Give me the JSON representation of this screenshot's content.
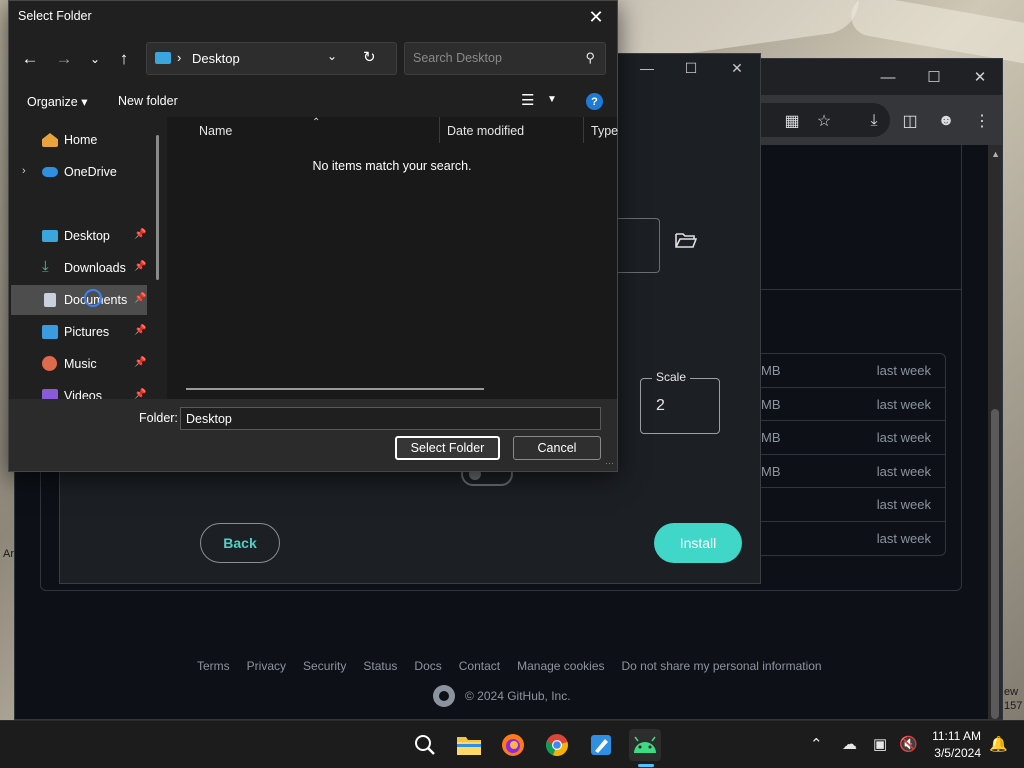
{
  "dialog": {
    "title": "Select Folder",
    "address": "Desktop",
    "search_placeholder": "Search Desktop",
    "organize_label": "Organize",
    "new_folder_label": "New folder",
    "nav_items": [
      {
        "label": "Home",
        "icon": "home-icon"
      },
      {
        "label": "OneDrive",
        "icon": "onedrive-icon"
      },
      {
        "label": "Desktop",
        "icon": "desktop-folder-icon"
      },
      {
        "label": "Downloads",
        "icon": "downloads-icon"
      },
      {
        "label": "Documents",
        "icon": "documents-icon"
      },
      {
        "label": "Pictures",
        "icon": "pictures-icon"
      },
      {
        "label": "Music",
        "icon": "music-icon"
      },
      {
        "label": "Videos",
        "icon": "videos-icon"
      }
    ],
    "columns": {
      "name": "Name",
      "date_modified": "Date modified",
      "type": "Type"
    },
    "empty_message": "No items match your search.",
    "folder_label": "Folder:",
    "folder_value": "Desktop",
    "select_button": "Select Folder",
    "cancel_button": "Cancel"
  },
  "app": {
    "scale_label": "Scale",
    "scale_value": "2",
    "back_button": "Back",
    "install_button": "Install"
  },
  "github": {
    "asset_sizes": [
      "MB",
      "MB",
      "MB",
      "MB"
    ],
    "asset_dates": [
      "last week",
      "last week",
      "last week",
      "last week",
      "last week",
      "last week"
    ],
    "footer_links": [
      "Terms",
      "Privacy",
      "Security",
      "Status",
      "Docs",
      "Contact",
      "Manage cookies",
      "Do not share my personal information"
    ],
    "copyright": "© 2024 GitHub, Inc."
  },
  "taskbar": {
    "time": "11:11 AM",
    "date": "3/5/2024"
  },
  "colors": {
    "accent_teal": "#40d6c8",
    "dialog_bg": "#202020",
    "github_bg": "#0d1117"
  }
}
